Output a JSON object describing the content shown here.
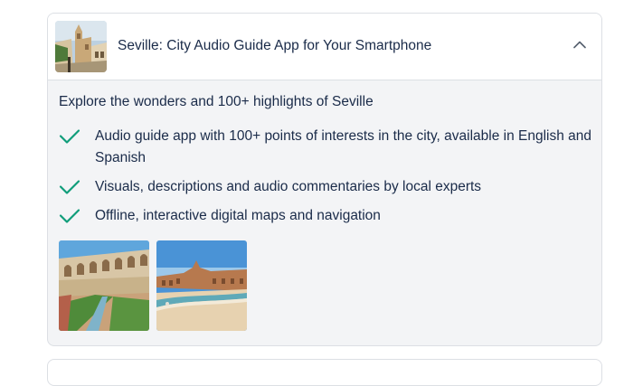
{
  "card": {
    "title": "Seville: City Audio Guide App for Your Smartphone",
    "thumbnail": "seville-street-cathedral-photo",
    "toggle_icon": "chevron-up-icon",
    "intro": "Explore the wonders and 100+ highlights of Seville",
    "highlights": [
      "Audio guide app with 100+ points of interests in the city, available in English and Spanish",
      "Visuals, descriptions and audio commentaries by local experts",
      "Offline, interactive digital maps and navigation"
    ],
    "photos": [
      "alcazar-courtyard-photo",
      "plaza-de-espana-photo"
    ]
  },
  "colors": {
    "check": "#0f9d7a",
    "title": "#1a2b49",
    "panel_bg": "#f3f4f6",
    "border": "#dcdfe4"
  }
}
